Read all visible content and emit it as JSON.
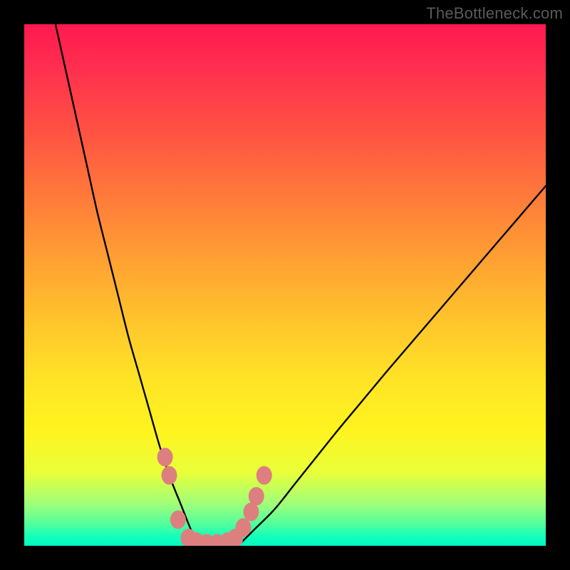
{
  "watermark": "TheBottleneck.com",
  "chart_data": {
    "type": "line",
    "title": "",
    "xlabel": "",
    "ylabel": "",
    "xlim": [
      0,
      100
    ],
    "ylim": [
      0,
      100
    ],
    "background_gradient": {
      "top_color": "#ff1950",
      "mid_color": "#ffe326",
      "bottom_color": "#00f9c2",
      "meaning": "red=high bottleneck, green=low bottleneck"
    },
    "series": [
      {
        "name": "left-curve",
        "x": [
          6,
          8,
          10,
          12,
          14,
          16,
          18,
          20,
          22,
          24,
          26,
          28,
          30,
          32,
          33.5
        ],
        "y": [
          100,
          91,
          82,
          73,
          64,
          56,
          48,
          40,
          33,
          26,
          19,
          13,
          8,
          3,
          0
        ]
      },
      {
        "name": "right-curve",
        "x": [
          41,
          44,
          48,
          52,
          56,
          60,
          65,
          70,
          76,
          82,
          88,
          94,
          100
        ],
        "y": [
          0,
          3,
          7,
          12,
          17,
          22,
          28,
          34,
          41,
          48,
          55,
          62,
          69
        ]
      }
    ],
    "markers": {
      "name": "data-points",
      "color": "#dd7f7f",
      "points": [
        {
          "x": 27.0,
          "y": 17.0
        },
        {
          "x": 27.8,
          "y": 13.5
        },
        {
          "x": 29.5,
          "y": 5.0
        },
        {
          "x": 31.5,
          "y": 1.5
        },
        {
          "x": 33.0,
          "y": 0.8
        },
        {
          "x": 35.0,
          "y": 0.5
        },
        {
          "x": 37.0,
          "y": 0.5
        },
        {
          "x": 39.0,
          "y": 0.8
        },
        {
          "x": 40.5,
          "y": 1.5
        },
        {
          "x": 42.0,
          "y": 3.5
        },
        {
          "x": 43.5,
          "y": 6.5
        },
        {
          "x": 44.5,
          "y": 9.5
        },
        {
          "x": 46.0,
          "y": 13.5
        }
      ]
    }
  }
}
